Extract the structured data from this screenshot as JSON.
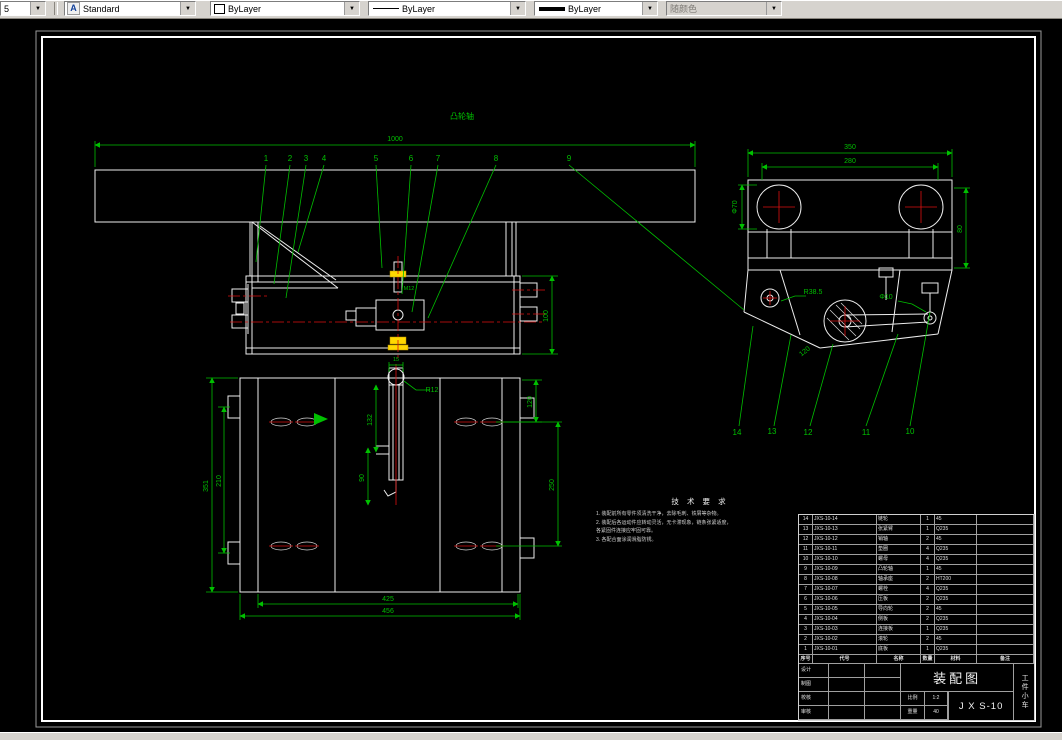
{
  "toolbar": {
    "layer_value": "5",
    "text_style": {
      "value": "Standard"
    },
    "color": {
      "value": "ByLayer"
    },
    "linetype": {
      "value": "ByLayer"
    },
    "lineweight": {
      "value": "ByLayer"
    },
    "plot_style": {
      "value": "随颜色"
    }
  },
  "drawing": {
    "part_label": "凸轮轴",
    "dims": {
      "overall_length": "1000",
      "side_width": "350",
      "side_inner_width": "280",
      "side_height": "80",
      "wheel_dia": "Φ70",
      "radius_r385": "R38.5",
      "pin_dia": "Φ10",
      "angle_120": "120",
      "channel_height": "100",
      "bolt_note": "M12",
      "plate_total_h": "351",
      "plate_bolt_h": "210",
      "plate_right_h": "250",
      "plate_top_h": "120",
      "slot_radius": "R12",
      "rod_len_132": "132",
      "rod_len_90": "90",
      "notch_15": "15",
      "base_inner_w": "425",
      "base_outer_w": "456"
    },
    "callouts_top": [
      "1",
      "2",
      "3",
      "4",
      "5",
      "6",
      "7",
      "8",
      "9"
    ],
    "callouts_right": [
      "14",
      "13",
      "12",
      "11",
      "10"
    ]
  },
  "tech": {
    "title": "技 术 要 求",
    "notes": [
      "1. 装配前所有零件须清洗干净，去除毛刺、铁屑等杂物。",
      "2. 装配后各运动件应转动灵活，无卡滞现象，链条张紧适度，",
      "    各紧固件连接应牢固可靠。",
      "3. 各配合面涂润滑脂防锈。"
    ]
  },
  "bom": {
    "headers": [
      "序号",
      "代号",
      "名称",
      "数量",
      "材料",
      "备注"
    ],
    "rows": [
      {
        "seq": "14",
        "code": "JXS-10-14",
        "name": "链轮",
        "qty": "1",
        "mat": "45",
        "note": ""
      },
      {
        "seq": "13",
        "code": "JXS-10-13",
        "name": "张紧臂",
        "qty": "1",
        "mat": "Q235",
        "note": ""
      },
      {
        "seq": "12",
        "code": "JXS-10-12",
        "name": "销轴",
        "qty": "2",
        "mat": "45",
        "note": ""
      },
      {
        "seq": "11",
        "code": "JXS-10-11",
        "name": "垫圈",
        "qty": "4",
        "mat": "Q235",
        "note": ""
      },
      {
        "seq": "10",
        "code": "JXS-10-10",
        "name": "螺母",
        "qty": "4",
        "mat": "Q235",
        "note": ""
      },
      {
        "seq": "9",
        "code": "JXS-10-09",
        "name": "凸轮轴",
        "qty": "1",
        "mat": "45",
        "note": ""
      },
      {
        "seq": "8",
        "code": "JXS-10-08",
        "name": "轴承座",
        "qty": "2",
        "mat": "HT200",
        "note": ""
      },
      {
        "seq": "7",
        "code": "JXS-10-07",
        "name": "螺栓",
        "qty": "4",
        "mat": "Q235",
        "note": ""
      },
      {
        "seq": "6",
        "code": "JXS-10-06",
        "name": "压板",
        "qty": "2",
        "mat": "Q235",
        "note": ""
      },
      {
        "seq": "5",
        "code": "JXS-10-05",
        "name": "导向轮",
        "qty": "2",
        "mat": "45",
        "note": ""
      },
      {
        "seq": "4",
        "code": "JXS-10-04",
        "name": "侧板",
        "qty": "2",
        "mat": "Q235",
        "note": ""
      },
      {
        "seq": "3",
        "code": "JXS-10-03",
        "name": "连接板",
        "qty": "1",
        "mat": "Q235",
        "note": ""
      },
      {
        "seq": "2",
        "code": "JXS-10-02",
        "name": "滚轮",
        "qty": "2",
        "mat": "45",
        "note": ""
      },
      {
        "seq": "1",
        "code": "JXS-10-01",
        "name": "底板",
        "qty": "1",
        "mat": "Q235",
        "note": ""
      }
    ],
    "title_block": {
      "project": "装配图",
      "code": "J X S-10",
      "side_label": "工件小车",
      "scale_label": "比例",
      "scale_value": "1:2",
      "weight_label": "重量",
      "weight_value": "40",
      "sign_labels": [
        "设计",
        "制图",
        "校核",
        "审核"
      ]
    }
  }
}
